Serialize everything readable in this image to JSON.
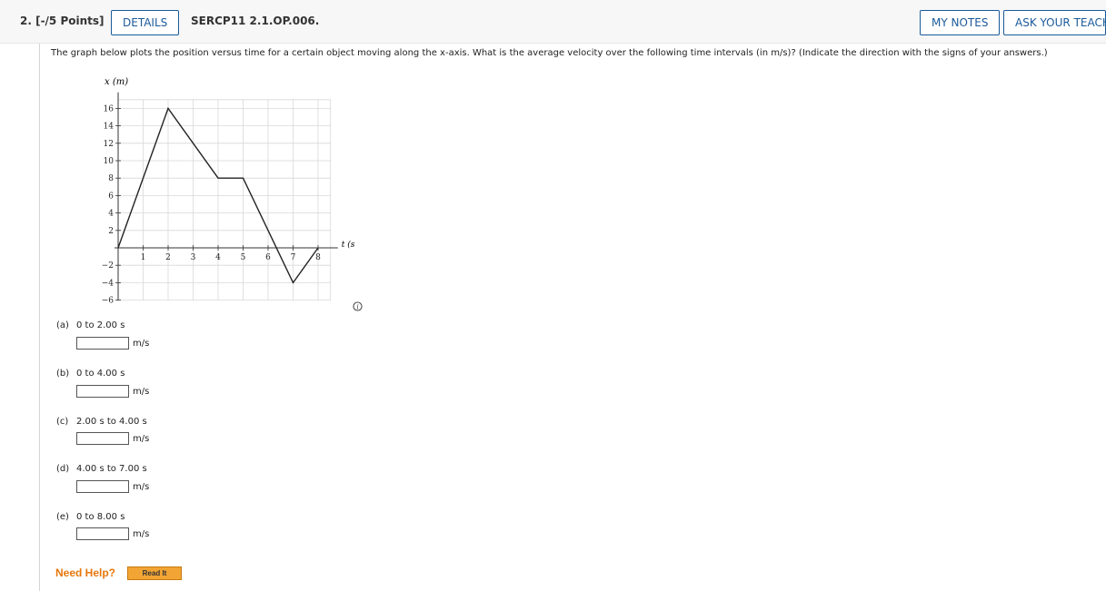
{
  "header": {
    "question_number": "2. [-/5 Points]",
    "details_label": "DETAILS",
    "question_id": "SERCP11 2.1.OP.006.",
    "my_notes_label": "MY NOTES",
    "ask_teacher_label": "ASK YOUR TEACHER"
  },
  "question_text": "The graph below plots the position versus time for a certain object moving along the x-axis. What is the average velocity over the following time intervals (in m/s)? (Indicate the direction with the signs of your answers.)",
  "graph": {
    "y_axis_label": "x (m)",
    "x_axis_label": "t (s)",
    "x_ticks": [
      "1",
      "2",
      "3",
      "4",
      "5",
      "6",
      "7",
      "8"
    ],
    "y_ticks": [
      "16",
      "14",
      "12",
      "10",
      "8",
      "6",
      "4",
      "2",
      "−2",
      "−4",
      "−6"
    ]
  },
  "chart_data": {
    "type": "line",
    "xlabel": "t (s)",
    "ylabel": "x (m)",
    "xlim": [
      0,
      8
    ],
    "ylim": [
      -6,
      17
    ],
    "grid": true,
    "series": [
      {
        "x": [
          0,
          2,
          4,
          5,
          7,
          8
        ],
        "y": [
          0,
          16,
          8,
          8,
          -4,
          0
        ]
      }
    ]
  },
  "parts": [
    {
      "letter": "(a)",
      "interval": "0 to 2.00 s",
      "unit": "m/s",
      "value": ""
    },
    {
      "letter": "(b)",
      "interval": "0 to 4.00 s",
      "unit": "m/s",
      "value": ""
    },
    {
      "letter": "(c)",
      "interval": "2.00 s to 4.00 s",
      "unit": "m/s",
      "value": ""
    },
    {
      "letter": "(d)",
      "interval": "4.00 s to 7.00 s",
      "unit": "m/s",
      "value": ""
    },
    {
      "letter": "(e)",
      "interval": "0 to 8.00 s",
      "unit": "m/s",
      "value": ""
    }
  ],
  "help": {
    "need_help_label": "Need Help?",
    "read_it_label": "Read It"
  },
  "icons": {
    "info": "info-icon"
  }
}
